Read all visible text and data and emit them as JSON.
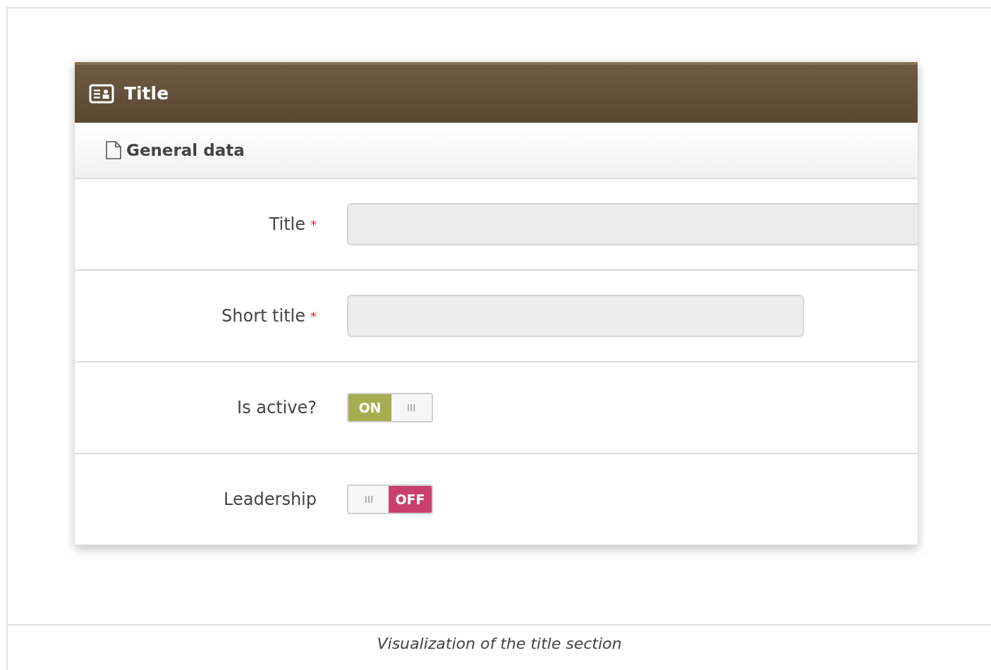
{
  "panel": {
    "title": "Title",
    "section": "General data"
  },
  "fields": [
    {
      "label": "Title",
      "kind": "text",
      "required_mark": "*",
      "wide": true
    },
    {
      "label": "Short title",
      "kind": "text",
      "required_mark": "*",
      "wide": false
    },
    {
      "label": "Is active?",
      "kind": "toggle",
      "on": true,
      "text": "ON"
    },
    {
      "label": "Leadership",
      "kind": "toggle",
      "on": false,
      "text": "OFF"
    }
  ],
  "caption": "Visualization of the title section"
}
